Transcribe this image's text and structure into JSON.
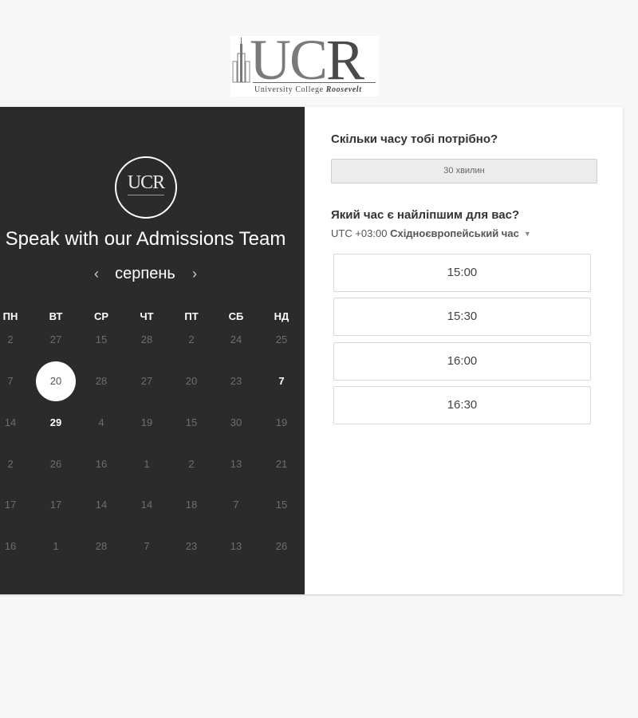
{
  "logo": {
    "letters": "UC",
    "letter_r": "R",
    "tagline_start": "University College ",
    "tagline_emph": "Roosevelt",
    "badge_text": "UCR"
  },
  "left_panel": {
    "title": "Speak with our Admissions Team",
    "month": "серпень",
    "prev_icon": "chevron-left-icon",
    "next_icon": "chevron-right-icon",
    "weekdays": [
      "ПН",
      "ВТ",
      "СР",
      "ЧТ",
      "ПТ",
      "СБ",
      "НД"
    ],
    "weeks": [
      [
        "2",
        "27",
        "15",
        "28",
        "2",
        "24",
        "25"
      ],
      [
        "7",
        "20",
        "28",
        "27",
        "20",
        "23",
        "7"
      ],
      [
        "14",
        "29",
        "4",
        "19",
        "15",
        "30",
        "19"
      ],
      [
        "2",
        "26",
        "16",
        "1",
        "2",
        "13",
        "21"
      ],
      [
        "17",
        "17",
        "14",
        "14",
        "18",
        "7",
        "15"
      ],
      [
        "16",
        "1",
        "28",
        "7",
        "23",
        "13",
        "26"
      ]
    ],
    "selected_day": "20",
    "available_days": [
      "7",
      "29"
    ]
  },
  "right_panel": {
    "duration_question": "Скільки часу тобі потрібно?",
    "duration_value": "30 хвилин",
    "time_question": "Який час є найліпшим для вас?",
    "timezone_offset": "UTC +03:00",
    "timezone_name": "Східноєвропейський час",
    "slots": [
      "15:00",
      "15:30",
      "16:00",
      "16:30"
    ]
  },
  "colors": {
    "panel_dark": "#2b2b2b",
    "page_bg": "#f7f7f7",
    "card_bg": "#ffffff"
  }
}
